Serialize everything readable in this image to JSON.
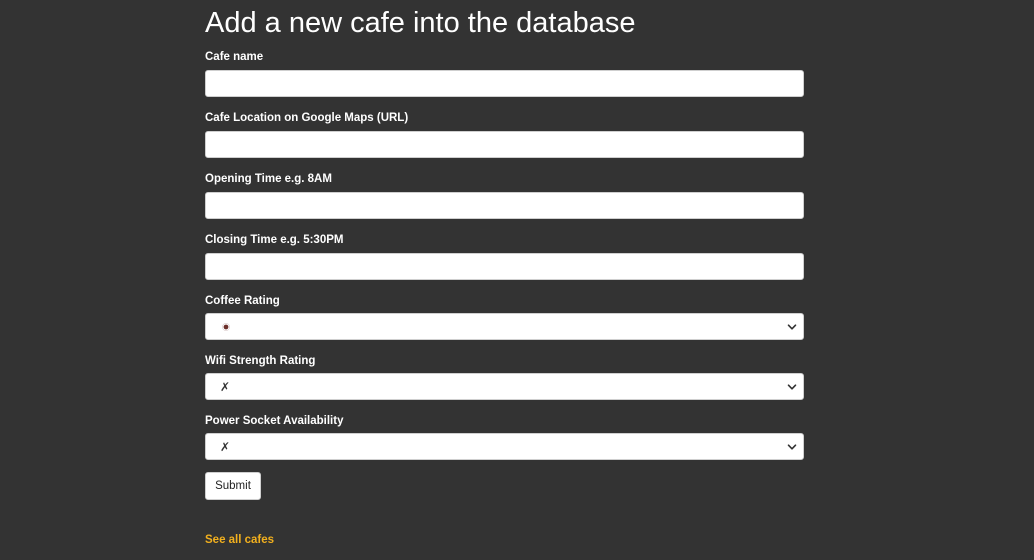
{
  "page": {
    "title": "Add a new cafe into the database"
  },
  "form": {
    "cafe_name": {
      "label": "Cafe name",
      "value": ""
    },
    "location": {
      "label": "Cafe Location on Google Maps (URL)",
      "value": ""
    },
    "opening_time": {
      "label": "Opening Time e.g. 8AM",
      "value": ""
    },
    "closing_time": {
      "label": "Closing Time e.g. 5:30PM",
      "value": ""
    },
    "coffee_rating": {
      "label": "Coffee Rating",
      "selected_icon": "coffee-cup-icon"
    },
    "wifi_rating": {
      "label": "Wifi Strength Rating",
      "selected": "✗"
    },
    "power_socket": {
      "label": "Power Socket Availability",
      "selected": "✗"
    },
    "submit_label": "Submit"
  },
  "links": {
    "see_all": "See all cafes"
  },
  "colors": {
    "background": "#333333",
    "link": "#f2b01e"
  }
}
